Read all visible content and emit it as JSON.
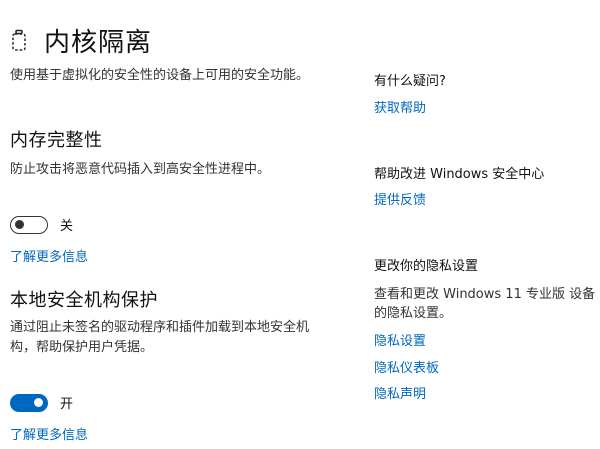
{
  "header": {
    "title": "内核隔离",
    "icon": "core-isolation-icon"
  },
  "intro": {
    "description": "使用基于虚拟化的安全性的设备上可用的安全功能。"
  },
  "memory_integrity": {
    "title": "内存完整性",
    "description": "防止攻击将恶意代码插入到高安全性进程中。",
    "toggle_state": "off",
    "toggle_label": "关",
    "learn_more": "了解更多信息"
  },
  "lsa_protection": {
    "title": "本地安全机构保护",
    "description": "通过阻止未签名的驱动程序和插件加载到本地安全机构，帮助保护用户凭据。",
    "toggle_state": "on",
    "toggle_label": "开",
    "learn_more": "了解更多信息"
  },
  "sidebar": {
    "question_heading": "有什么疑问?",
    "get_help": "获取帮助",
    "improve_heading": "帮助改进 Windows 安全中心",
    "give_feedback": "提供反馈",
    "privacy_heading": "更改你的隐私设置",
    "privacy_text": "查看和更改 Windows 11 专业版 设备的隐私设置。",
    "privacy_settings": "隐私设置",
    "privacy_dashboard": "隐私仪表板",
    "privacy_statement": "隐私声明"
  },
  "colors": {
    "accent": "#0067c0",
    "text": "#1a1a1a",
    "background": "#ffffff"
  }
}
